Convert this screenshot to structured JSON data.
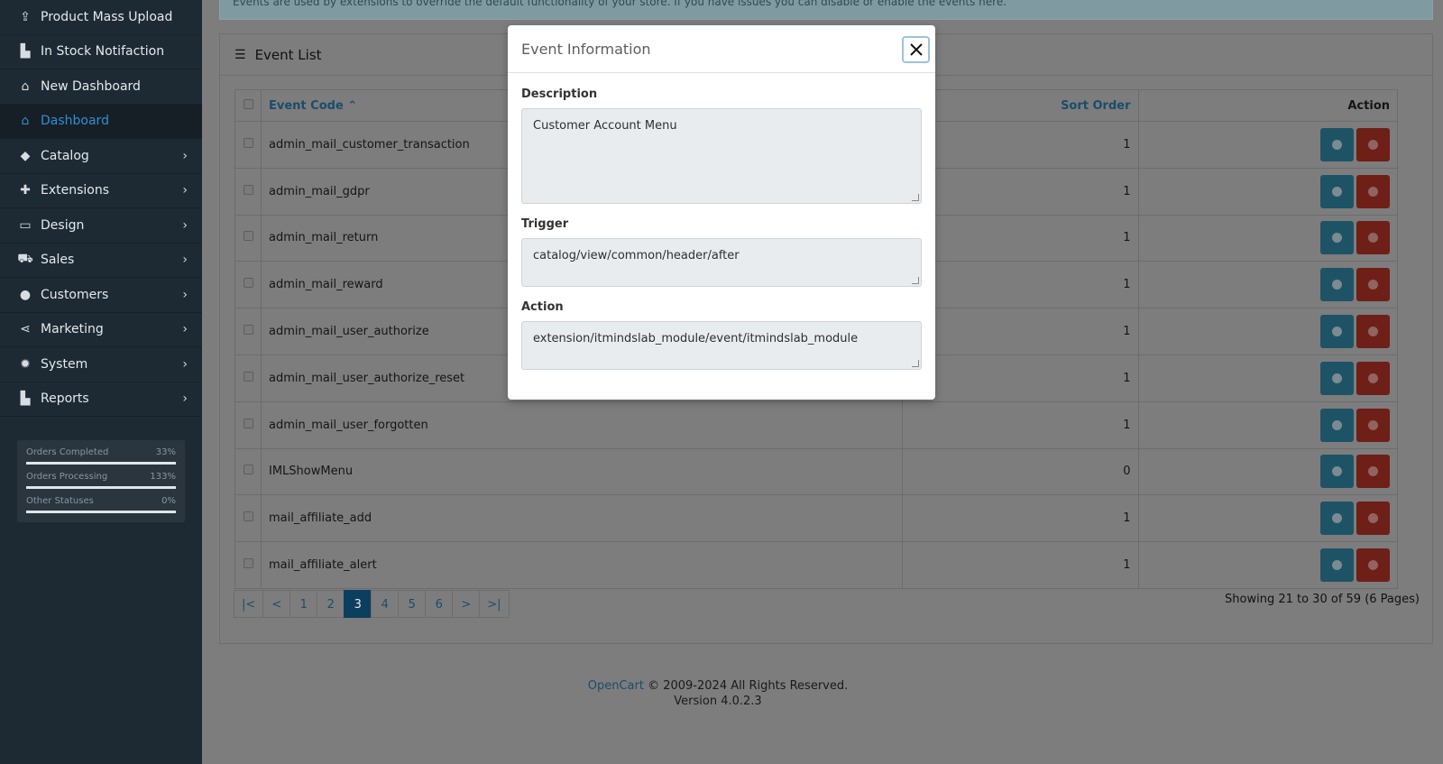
{
  "sidebar": {
    "items": [
      {
        "label": "Product Mass Upload",
        "icon": "upload-icon",
        "has_children": false,
        "active": false
      },
      {
        "label": "In Stock Notifaction",
        "icon": "chart-icon",
        "has_children": false,
        "active": false
      },
      {
        "label": "New Dashboard",
        "icon": "home-icon",
        "has_children": false,
        "active": false
      },
      {
        "label": "Dashboard",
        "icon": "home-icon",
        "has_children": false,
        "active": true
      },
      {
        "label": "Catalog",
        "icon": "tag-icon",
        "has_children": true,
        "active": false
      },
      {
        "label": "Extensions",
        "icon": "puzzle-icon",
        "has_children": true,
        "active": false
      },
      {
        "label": "Design",
        "icon": "monitor-icon",
        "has_children": true,
        "active": false
      },
      {
        "label": "Sales",
        "icon": "cart-icon",
        "has_children": true,
        "active": false
      },
      {
        "label": "Customers",
        "icon": "user-icon",
        "has_children": true,
        "active": false
      },
      {
        "label": "Marketing",
        "icon": "share-icon",
        "has_children": true,
        "active": false
      },
      {
        "label": "System",
        "icon": "gear-icon",
        "has_children": true,
        "active": false
      },
      {
        "label": "Reports",
        "icon": "chart-icon",
        "has_children": true,
        "active": false
      }
    ],
    "stats": [
      {
        "label": "Orders Completed",
        "value": "33%",
        "fill": 1.0
      },
      {
        "label": "Orders Processing",
        "value": "133%",
        "fill": 1.0
      },
      {
        "label": "Other Statuses",
        "value": "0%",
        "fill": 1.0
      }
    ]
  },
  "alert": {
    "text": "Events are used by extensions to override the default functionality of your store. If you have issues you can disable or enable the events here."
  },
  "panel": {
    "title": "Event List",
    "icon": "list-icon"
  },
  "table": {
    "headers": {
      "code": "Event Code",
      "sort": "Sort Order",
      "action": "Action"
    },
    "rows": [
      {
        "code": "admin_mail_customer_transaction",
        "sort": "1"
      },
      {
        "code": "admin_mail_gdpr",
        "sort": "1"
      },
      {
        "code": "admin_mail_return",
        "sort": "1"
      },
      {
        "code": "admin_mail_reward",
        "sort": "1"
      },
      {
        "code": "admin_mail_user_authorize",
        "sort": "1"
      },
      {
        "code": "admin_mail_user_authorize_reset",
        "sort": "1"
      },
      {
        "code": "admin_mail_user_forgotten",
        "sort": "1"
      },
      {
        "code": "IMLShowMenu",
        "sort": "0"
      },
      {
        "code": "mail_affiliate_add",
        "sort": "1"
      },
      {
        "code": "mail_affiliate_alert",
        "sort": "1"
      }
    ]
  },
  "pagination": {
    "items": [
      "|<",
      "<",
      "1",
      "2",
      "3",
      "4",
      "5",
      "6",
      ">",
      ">|"
    ],
    "active": "3",
    "summary": "Showing 21 to 30 of 59 (6 Pages)"
  },
  "footer": {
    "link": "OpenCart",
    "copyright": "© 2009-2024 All Rights Reserved.",
    "version": "Version 4.0.2.3"
  },
  "modal": {
    "title": "Event Information",
    "description_label": "Description",
    "description_value": "Customer Account Menu",
    "trigger_label": "Trigger",
    "trigger_value": "catalog/view/common/header/after",
    "action_label": "Action",
    "action_value": "extension/itmindslab_module/event/itmindslab_module"
  },
  "colors": {
    "accent": "#2f8fd3",
    "sidebar_bg": "#1e2a33",
    "info_btn": "#1e5366",
    "delete_btn": "#6e1f18"
  }
}
